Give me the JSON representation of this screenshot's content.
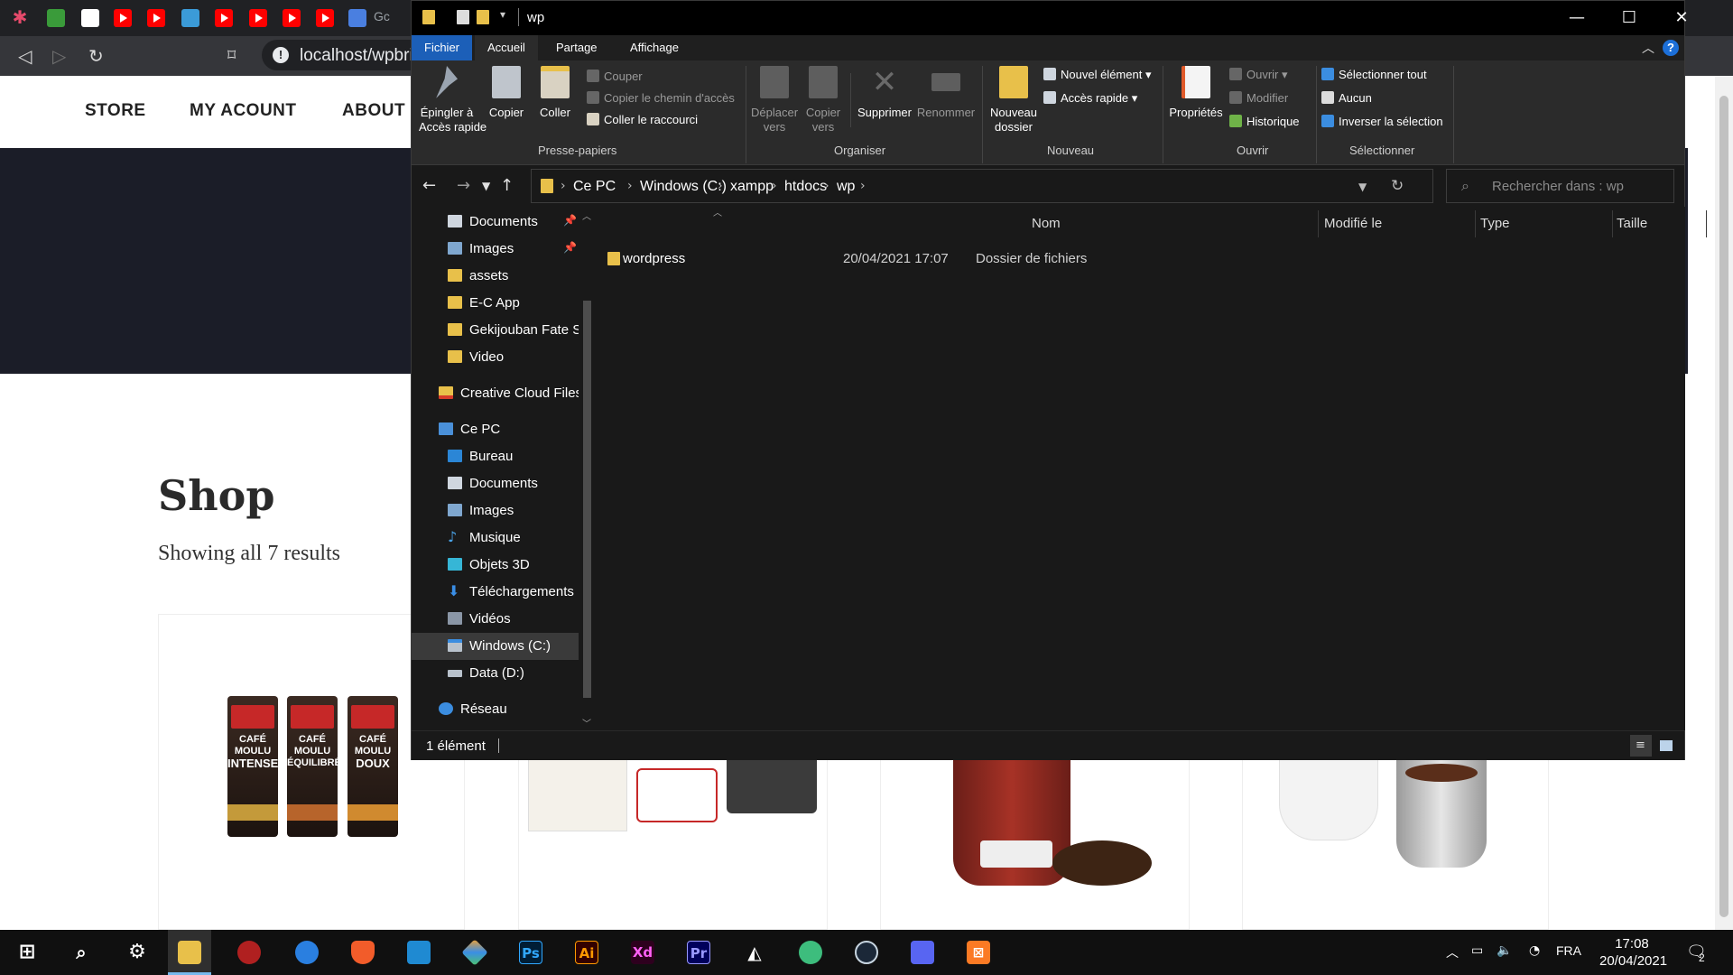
{
  "browser": {
    "url": "localhost/wpbri",
    "tab_partial_text": "Gc",
    "site_nav": [
      "STORE",
      "MY ACOUNT",
      "ABOUT"
    ],
    "shop": {
      "title": "Shop",
      "count": "Showing all 7 results"
    },
    "products": [
      "cafe-moulu-intense",
      "cafe-moulu-equilibre",
      "cafe-moulu-doux"
    ],
    "product_bags": [
      {
        "line1": "CAFÉ MOULU",
        "line2": "INTENSE",
        "band": "#c49a3a"
      },
      {
        "line1": "CAFÉ MOULU",
        "line2": "ÉQUILIBRÉ",
        "band": "#b7642b"
      },
      {
        "line1": "CAFÉ MOULU",
        "line2": "DOUX",
        "band": "#d08a2f"
      }
    ]
  },
  "explorer": {
    "title": "wp",
    "tabs": [
      "Fichier",
      "Accueil",
      "Partage",
      "Affichage"
    ],
    "ribbon": {
      "pin": "Épingler à\nAccès rapide",
      "copy": "Copier",
      "paste": "Coller",
      "cut": "Couper",
      "copy_path": "Copier le chemin d'accès",
      "paste_shortcut": "Coller le raccourci",
      "clipboard_group": "Presse-papiers",
      "move": "Déplacer\nvers",
      "copy_to": "Copier\nvers",
      "delete": "Supprimer",
      "rename": "Renommer",
      "organize_group": "Organiser",
      "new_folder": "Nouveau\ndossier",
      "new_item": "Nouvel élément",
      "quick_access": "Accès rapide",
      "new_group": "Nouveau",
      "properties": "Propriétés",
      "open": "Ouvrir",
      "edit": "Modifier",
      "history": "Historique",
      "open_group": "Ouvrir",
      "select_all": "Sélectionner tout",
      "select_none": "Aucun",
      "invert": "Inverser la sélection",
      "select_group": "Sélectionner"
    },
    "breadcrumb": [
      "Ce PC",
      "Windows (C:)",
      "xampp",
      "htdocs",
      "wp"
    ],
    "search_placeholder": "Rechercher dans : wp",
    "nav": [
      {
        "label": "Documents",
        "icon": "documents-icon",
        "pinned": true
      },
      {
        "label": "Images",
        "icon": "images-icon",
        "pinned": true
      },
      {
        "label": "assets",
        "icon": "folder-icon"
      },
      {
        "label": "E-C App",
        "icon": "folder-icon"
      },
      {
        "label": "Gekijouban Fate S",
        "icon": "folder-icon"
      },
      {
        "label": "Video",
        "icon": "folder-icon"
      },
      {
        "label": "Creative Cloud Files",
        "icon": "creative-cloud-icon"
      },
      {
        "label": "Ce PC",
        "icon": "computer-icon"
      },
      {
        "label": "Bureau",
        "icon": "desktop-icon"
      },
      {
        "label": "Documents",
        "icon": "documents-icon"
      },
      {
        "label": "Images",
        "icon": "images-icon"
      },
      {
        "label": "Musique",
        "icon": "music-icon"
      },
      {
        "label": "Objets 3D",
        "icon": "objects-3d-icon"
      },
      {
        "label": "Téléchargements",
        "icon": "downloads-icon"
      },
      {
        "label": "Vidéos",
        "icon": "videos-icon"
      },
      {
        "label": "Windows (C:)",
        "icon": "drive-c-icon",
        "selected": true
      },
      {
        "label": "Data (D:)",
        "icon": "drive-d-icon"
      },
      {
        "label": "Réseau",
        "icon": "network-icon"
      }
    ],
    "columns": [
      "Nom",
      "Modifié le",
      "Type",
      "Taille"
    ],
    "files": [
      {
        "name": "wordpress",
        "modified": "20/04/2021 17:07",
        "type": "Dossier de fichiers",
        "size": ""
      }
    ],
    "status": "1 élément"
  },
  "taskbar": {
    "apps": [
      "start",
      "search",
      "settings",
      "file-explorer",
      "app-red",
      "app-blue",
      "brave",
      "vscode",
      "git",
      "photoshop",
      "illustrator",
      "xd",
      "premiere",
      "unity",
      "app-green",
      "steam",
      "discord",
      "xampp"
    ],
    "language": "FRA",
    "time": "17:08",
    "date": "20/04/2021",
    "notifications": "2"
  }
}
